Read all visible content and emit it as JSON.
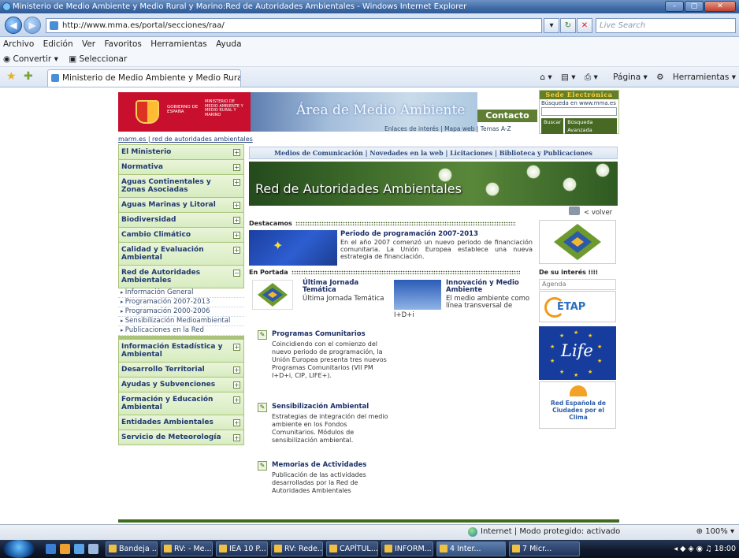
{
  "window": {
    "title": "Ministerio de Medio Ambiente y Medio Rural y Marino:Red de Autoridades Ambientales - Windows Internet Explorer",
    "minimize": "–",
    "maximize": "▢",
    "close": "✕"
  },
  "address": {
    "url": "http://www.mma.es/portal/secciones/raa/",
    "search_placeholder": "Live Search"
  },
  "menu": [
    "Archivo",
    "Edición",
    "Ver",
    "Favoritos",
    "Herramientas",
    "Ayuda"
  ],
  "convert": {
    "convertir": "Convertir",
    "seleccionar": "Seleccionar"
  },
  "tab": {
    "label": "Ministerio de Medio Ambiente y Medio Rural y M..."
  },
  "tools": {
    "page": "Página",
    "tools": "Herramientas"
  },
  "header": {
    "gov_text": "GOBIERNO DE ESPAÑA",
    "ministry_text": "MINISTERIO DE MEDIO AMBIENTE Y MEDIO RURAL Y MARINO",
    "area_title": "Área de Medio Ambiente",
    "contacto": "Contacto",
    "sede_title": "Sede Electrónica",
    "search_label": "Búsqueda en www.mma.es",
    "buscar": "Buscar",
    "busqueda_avanzada": "Búsqueda Avanzada",
    "links": "Enlaces de interés | Mapa web | Temas A-Z"
  },
  "breadcrumb": "marm.es | red de autoridades ambientales",
  "left_menu": {
    "items_top": [
      {
        "label": "El Ministerio",
        "toggle": "+"
      },
      {
        "label": "Normativa",
        "toggle": "+"
      },
      {
        "label": "Aguas Continentales y Zonas Asociadas",
        "toggle": "+"
      },
      {
        "label": "Aguas Marinas y Litoral",
        "toggle": "+"
      },
      {
        "label": "Biodiversidad",
        "toggle": "+"
      },
      {
        "label": "Cambio Climático",
        "toggle": "+"
      },
      {
        "label": "Calidad y Evaluación Ambiental",
        "toggle": "+"
      },
      {
        "label": "Red de Autoridades Ambientales",
        "toggle": "−"
      }
    ],
    "sub_items": [
      "Información General",
      "Programación 2007-2013",
      "Programación 2000-2006",
      "Sensibilización Medioambiental",
      "Publicaciones en la Red"
    ],
    "items_bottom": [
      {
        "label": "Información Estadística y Ambiental",
        "toggle": "+"
      },
      {
        "label": "Desarrollo Territorial",
        "toggle": "+"
      },
      {
        "label": "Ayudas y Subvenciones",
        "toggle": "+"
      },
      {
        "label": "Formación y Educación Ambiental",
        "toggle": "+"
      },
      {
        "label": "Entidades Ambientales",
        "toggle": "+"
      },
      {
        "label": "Servicio de Meteorología",
        "toggle": "+"
      }
    ]
  },
  "top_nav": "Medios de Comunicación  |  Novedades en la web  |  Licitaciones  |  Biblioteca y Publicaciones",
  "hero_title": "Red de Autoridades Ambientales",
  "volver": "< volver",
  "destacamos": {
    "heading": "Destacamos",
    "title": "Periodo de programación 2007-2013",
    "text": "En el año 2007 comenzó un nuevo periodo de financiación comunitaria. La Unión Europea establece una nueva estrategia de financiación."
  },
  "portada": {
    "heading": "En Portada",
    "items": [
      {
        "title": "Última Jornada Temática",
        "text": "Última Jornada Temática"
      },
      {
        "title": "Innovación y Medio Ambiente",
        "text": "El medio ambiente como línea transversal de",
        "caption": "I+D+i"
      }
    ]
  },
  "programas": [
    {
      "title": "Programas Comunitarios",
      "text": "Coincidiendo con el comienzo del nuevo periodo de programación, la Unión Europea presenta tres nuevos Programas Comunitarios (VII PM I+D+i, CIP, LIFE+)."
    },
    {
      "title": "Sensibilización Ambiental",
      "text": "Estrategias de integración del medio ambiente en los Fondos Comunitarios. Módulos de sensibilización ambiental."
    },
    {
      "title": "Memorias de Actividades",
      "text": "Publicación de las actividades desarrolladas por la Red de Autoridades Ambientales"
    }
  ],
  "right": {
    "de_su_interes": "De su interés",
    "agenda": "Agenda",
    "etap": "ETAP",
    "life": "Life",
    "red_esp": "Red Española de Ciudades por el Clima"
  },
  "status": {
    "zone": "Internet | Modo protegido: activado",
    "zoom": "100%"
  },
  "taskbar": {
    "tasks": [
      "Bandeja ...",
      "RV: - Me...",
      "IEA 10 P...",
      "RV: Rede...",
      "CAPÍTUL...",
      "INFORM...",
      "4 Inter...",
      "7 Micr..."
    ],
    "clock": "18:00"
  },
  "colors": {
    "menu_green": "#d7ecc0",
    "header_green": "#5f7e34",
    "link_blue": "#1c2f66",
    "gov_red": "#c8102e"
  }
}
